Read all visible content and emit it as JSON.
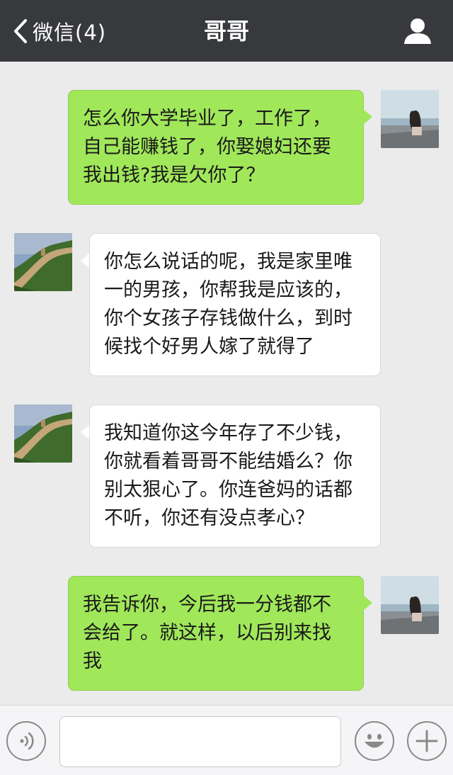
{
  "navbar": {
    "back_label": "微信(4)",
    "title": "哥哥"
  },
  "messages": [
    {
      "direction": "out",
      "text": "怎么你大学毕业了，工作了，\n自己能赚钱了，你娶媳妇还要\n我出钱?我是欠你了？"
    },
    {
      "direction": "in",
      "text": "你怎么说话的呢，我是家里唯\n一的男孩，你帮我是应该的，\n你个女孩子存钱做什么，到时\n候找个好男人嫁了就得了"
    },
    {
      "direction": "in",
      "text": "我知道你这今年存了不少钱，\n你就看着哥哥不能结婚么？你\n别太狠心了。你连爸妈的话都\n不听，你还有没点孝心？"
    },
    {
      "direction": "out",
      "text": "我告诉你，今后我一分钱都不\n会给了。就这样，以后别来找\n我"
    }
  ],
  "input": {
    "value": "",
    "placeholder": ""
  },
  "colors": {
    "navbar": "#37393c",
    "chat_background": "#ebebeb",
    "outgoing_bubble": "#a0e75a",
    "incoming_bubble": "#ffffff"
  },
  "icons": {
    "back": "chevron-left-icon",
    "profile": "person-icon",
    "voice": "voice-icon",
    "emoji": "smiley-icon",
    "more": "plus-icon"
  }
}
